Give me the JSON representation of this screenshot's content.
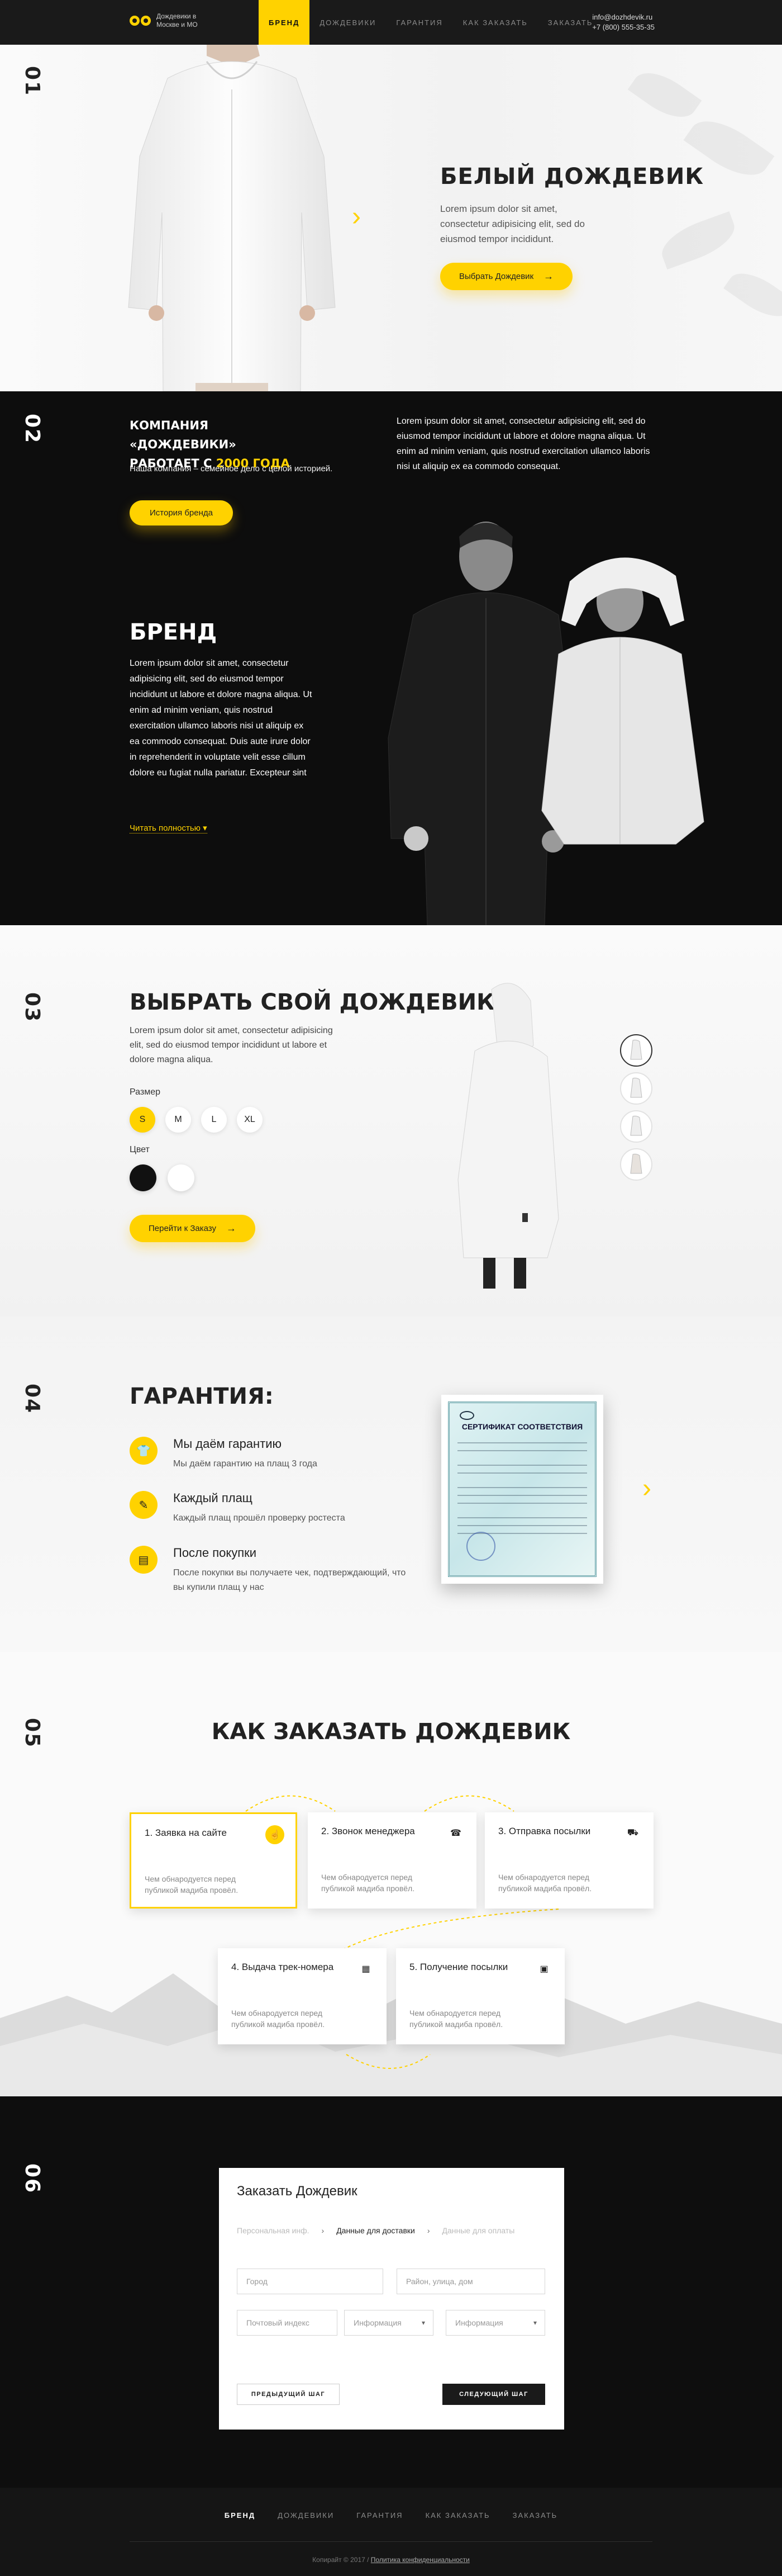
{
  "header": {
    "logo_text": "Дождевики в Москве и МО",
    "nav": [
      "БРЕНД",
      "ДОЖДЕВИКИ",
      "ГАРАНТИЯ",
      "КАК ЗАКАЗАТЬ",
      "ЗАКАЗАТЬ"
    ],
    "active_nav": "БРЕНД",
    "email": "info@dozhdevik.ru",
    "phone": "+7 (800) 555-35-35"
  },
  "hero": {
    "number": "01",
    "title": "БЕЛЫЙ ДОЖДЕВИК",
    "text": "Lorem ipsum dolor sit amet, consectetur adipisicing elit, sed do eiusmod tempor incididunt.",
    "button": "Выбрать Дождевик"
  },
  "brand": {
    "number": "02",
    "company_line1": "КОМПАНИЯ «ДОЖДЕВИКИ»",
    "company_line2a": "РАБОТАЕТ С ",
    "company_year": "2000 ГОДА",
    "company_sub": "Наша компания – семейное дело с целой историей.",
    "lorem": "Lorem ipsum dolor sit amet, consectetur adipisicing elit, sed do eiusmod tempor incididunt ut labore et dolore magna aliqua. Ut enim ad minim veniam, quis nostrud exercitation ullamco laboris nisi ut aliquip ex ea commodo consequat.",
    "history_button": "История бренда",
    "title": "БРЕНД",
    "body": "Lorem ipsum dolor sit amet, consectetur adipisicing elit, sed do eiusmod tempor incididunt ut labore et dolore magna aliqua. Ut enim ad minim veniam, quis nostrud exercitation ullamco laboris nisi ut aliquip ex ea commodo consequat. Duis aute irure dolor in reprehenderit in voluptate velit esse cillum dolore eu fugiat nulla pariatur. Excepteur sint",
    "read_more": "Читать полностью"
  },
  "choose": {
    "number": "03",
    "title": "ВЫБРАТЬ СВОЙ ДОЖДЕВИК",
    "text": "Lorem ipsum dolor sit amet, consectetur adipisicing elit, sed do eiusmod tempor incididunt ut labore et dolore magna aliqua.",
    "size_label": "Размер",
    "sizes": [
      "S",
      "M",
      "L",
      "XL"
    ],
    "selected_size": "S",
    "color_label": "Цвет",
    "colors": [
      "#111111",
      "#ffffff"
    ],
    "button": "Перейти к Заказу"
  },
  "warranty": {
    "number": "04",
    "title": "ГАРАНТИЯ:",
    "features": [
      {
        "title": "Мы даём гарантию",
        "text": "Мы даём гарантию на плащ 3 года"
      },
      {
        "title": "Каждый плащ",
        "text": "Каждый  плащ прошёл проверку ростеста"
      },
      {
        "title": "После покупки",
        "text": "После покупки вы получаете чек, подтверждающий, что вы купили плащ у нас"
      }
    ],
    "cert_title": "СЕРТИФИКАТ СООТВЕТСТВИЯ"
  },
  "how": {
    "number": "05",
    "title": "КАК ЗАКАЗАТЬ ДОЖДЕВИК",
    "steps": [
      {
        "title": "1. Заявка на сайте",
        "text": "Чем обнародуется перед публикой мадиба провёл."
      },
      {
        "title": "2. Звонок менеджера",
        "text": "Чем обнародуется перед публикой мадиба провёл."
      },
      {
        "title": "3. Отправка посылки",
        "text": "Чем обнародуется перед публикой мадиба провёл."
      },
      {
        "title": "4. Выдача трек-номера",
        "text": "Чем обнародуется перед публикой мадиба провёл."
      },
      {
        "title": "5. Получение посылки",
        "text": "Чем обнародуется перед публикой мадиба провёл."
      }
    ]
  },
  "form": {
    "number": "06",
    "title": "Заказать Дождевик",
    "tabs": [
      "Персональная инф.",
      "Данные для доставки",
      "Данные для оплаты"
    ],
    "active_tab": "Данные для доставки",
    "city_placeholder": "Город",
    "district_placeholder": "Район, улица, дом",
    "zip_placeholder": "Почтовый индекс",
    "info1": "Информация",
    "info2": "Информация",
    "prev": "ПРЕДЫДУЩИЙ ШАГ",
    "next": "СЛЕДУЮЩИЙ ШАГ"
  },
  "footer": {
    "nav": [
      "БРЕНД",
      "ДОЖДЕВИКИ",
      "ГАРАНТИЯ",
      "КАК ЗАКАЗАТЬ",
      "ЗАКАЗАТЬ"
    ],
    "copyright": "Копирайт © 2017 / ",
    "policy": "Политика конфиденциальности"
  }
}
